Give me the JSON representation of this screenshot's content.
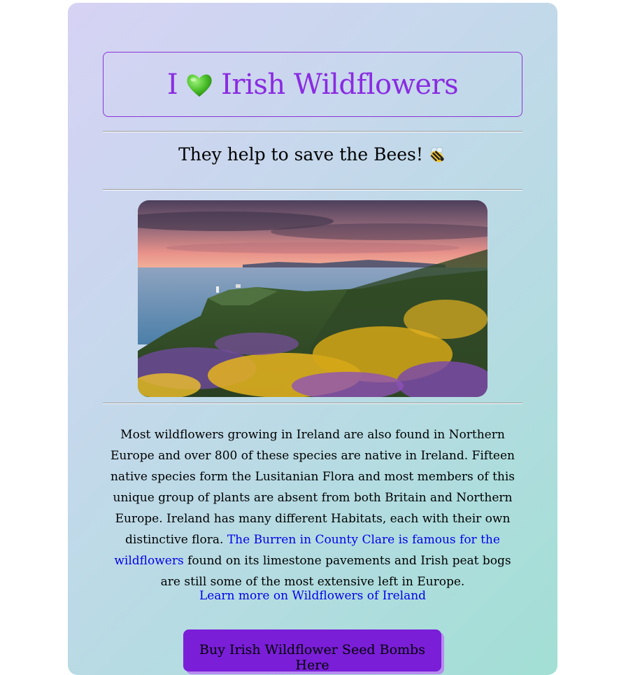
{
  "header": {
    "title_prefix": "I",
    "title_icon": "green-heart-icon",
    "title_text": "Irish Wildflowers",
    "subtitle_text": "They help to save the Bees!",
    "subtitle_icon": "bee-icon"
  },
  "hero_image": {
    "alt": "Wildflowers on an Irish coastal headland at sunset"
  },
  "article": {
    "paragraph_before_link": "Most wildflowers growing in Ireland are also found in Northern Europe and over 800 of these species are native in Ireland. Fifteen native species form the Lusitanian Flora and most members of this unique group of plants are absent from both Britain and Northern Europe. Ireland has many different Habitats, each with their own distinctive flora.",
    "inline_link": "The Burren in County Clare is famous for the wildflowers",
    "paragraph_after_link": "found on its limestone pavements and Irish peat bogs are still some of the most extensive left in Europe."
  },
  "learn_more_link": "Learn more on Wildflowers of Ireland",
  "seed_button_label": "Buy Irish Wildflower Seed Bombs Here",
  "colors": {
    "title": "#8a2be2",
    "link": "#0000ee",
    "button": "#7a1ed8",
    "card_gradient_start": "#d6d2f4",
    "card_gradient_end": "#a2dfd4"
  }
}
